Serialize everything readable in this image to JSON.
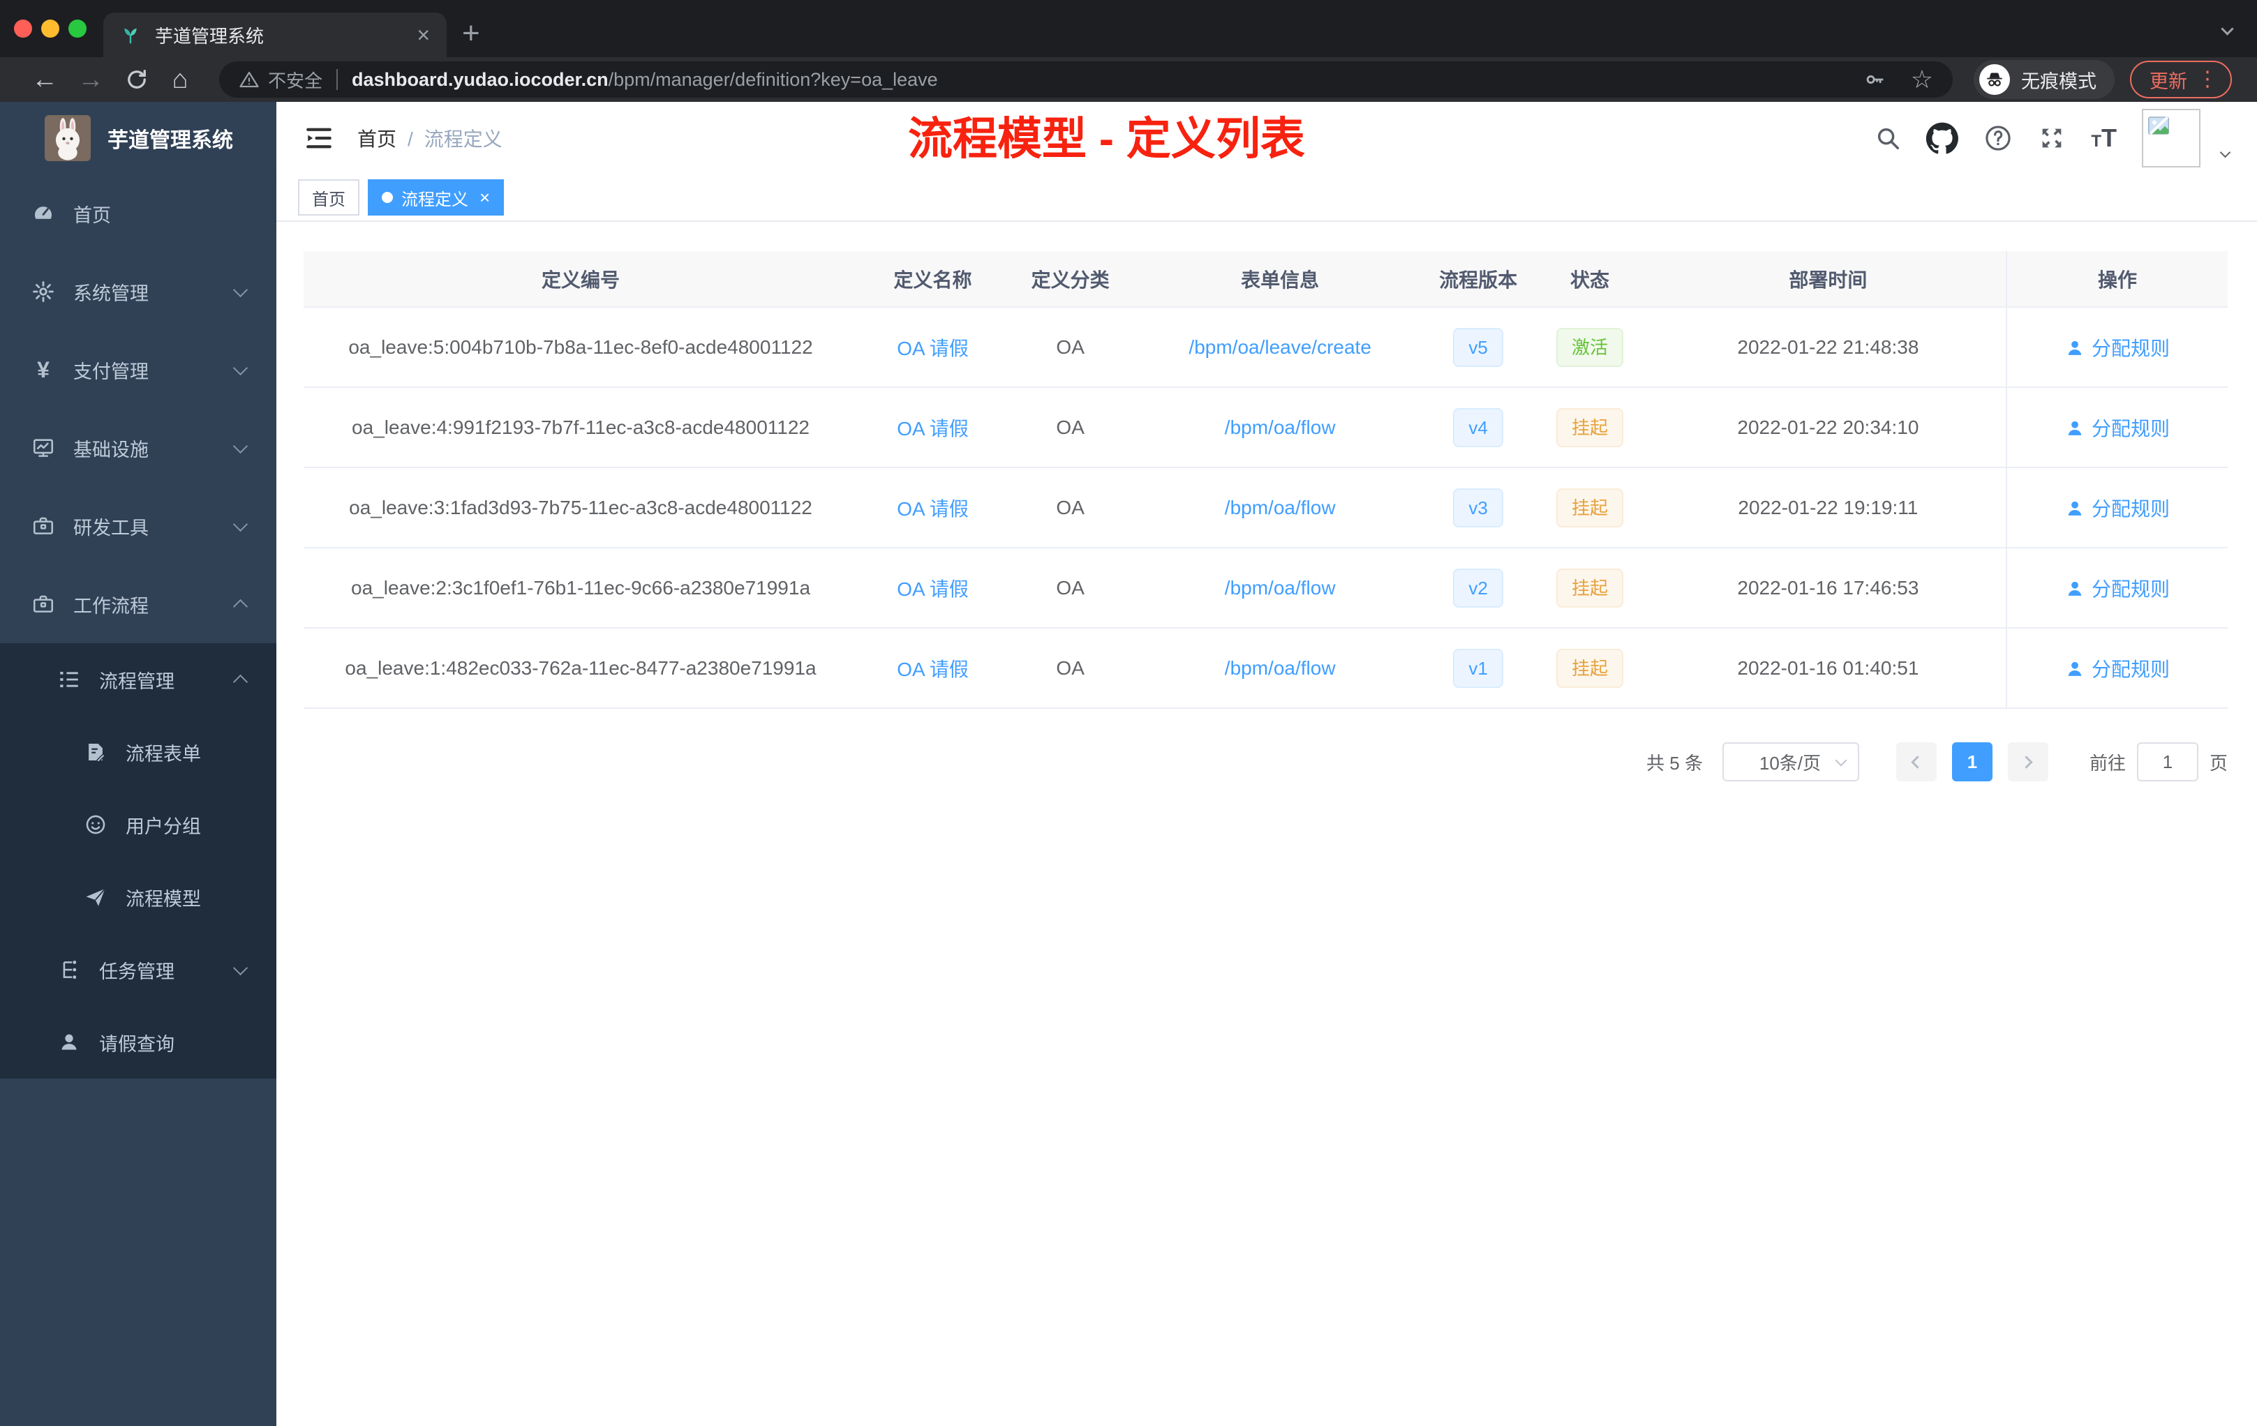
{
  "browser": {
    "tab_title": "芋道管理系统",
    "security_label": "不安全",
    "url_domain": "dashboard.yudao.iocoder.cn",
    "url_path": "/bpm/manager/definition?key=oa_leave",
    "incognito_label": "无痕模式",
    "update_label": "更新"
  },
  "sidebar": {
    "logo_title": "芋道管理系统",
    "items": [
      {
        "icon": "dashboard",
        "label": "首页",
        "level": 0
      },
      {
        "icon": "gear",
        "label": "系统管理",
        "level": 0,
        "arrow": "down"
      },
      {
        "icon": "yen",
        "label": "支付管理",
        "level": 0,
        "arrow": "down"
      },
      {
        "icon": "infra",
        "label": "基础设施",
        "level": 0,
        "arrow": "down"
      },
      {
        "icon": "toolbox",
        "label": "研发工具",
        "level": 0,
        "arrow": "down"
      },
      {
        "icon": "toolbox",
        "label": "工作流程",
        "level": 0,
        "arrow": "up"
      },
      {
        "icon": "listicon",
        "label": "流程管理",
        "level": 1,
        "arrow": "up"
      },
      {
        "icon": "form",
        "label": "流程表单",
        "level": 2
      },
      {
        "icon": "group",
        "label": "用户分组",
        "level": 2
      },
      {
        "icon": "plane",
        "label": "流程模型",
        "level": 2
      },
      {
        "icon": "task",
        "label": "任务管理",
        "level": 1,
        "arrow": "down"
      },
      {
        "icon": "person",
        "label": "请假查询",
        "level": 1
      }
    ]
  },
  "header": {
    "breadcrumb_home": "首页",
    "breadcrumb_current": "流程定义",
    "annotation": "流程模型 - 定义列表"
  },
  "tags": {
    "items": [
      {
        "label": "首页",
        "active": false
      },
      {
        "label": "流程定义",
        "active": true
      }
    ]
  },
  "table": {
    "columns": [
      "定义编号",
      "定义名称",
      "定义分类",
      "表单信息",
      "流程版本",
      "状态",
      "部署时间",
      "操作"
    ],
    "rows": [
      {
        "id": "oa_leave:5:004b710b-7b8a-11ec-8ef0-acde48001122",
        "name": "OA 请假",
        "category": "OA",
        "form": "/bpm/oa/leave/create",
        "version": "v5",
        "status": "激活",
        "status_type": "success",
        "time": "2022-01-22 21:48:38",
        "action": "分配规则"
      },
      {
        "id": "oa_leave:4:991f2193-7b7f-11ec-a3c8-acde48001122",
        "name": "OA 请假",
        "category": "OA",
        "form": "/bpm/oa/flow",
        "version": "v4",
        "status": "挂起",
        "status_type": "warning",
        "time": "2022-01-22 20:34:10",
        "action": "分配规则"
      },
      {
        "id": "oa_leave:3:1fad3d93-7b75-11ec-a3c8-acde48001122",
        "name": "OA 请假",
        "category": "OA",
        "form": "/bpm/oa/flow",
        "version": "v3",
        "status": "挂起",
        "status_type": "warning",
        "time": "2022-01-22 19:19:11",
        "action": "分配规则"
      },
      {
        "id": "oa_leave:2:3c1f0ef1-76b1-11ec-9c66-a2380e71991a",
        "name": "OA 请假",
        "category": "OA",
        "form": "/bpm/oa/flow",
        "version": "v2",
        "status": "挂起",
        "status_type": "warning",
        "time": "2022-01-16 17:46:53",
        "action": "分配规则"
      },
      {
        "id": "oa_leave:1:482ec033-762a-11ec-8477-a2380e71991a",
        "name": "OA 请假",
        "category": "OA",
        "form": "/bpm/oa/flow",
        "version": "v1",
        "status": "挂起",
        "status_type": "warning",
        "time": "2022-01-16 01:40:51",
        "action": "分配规则"
      }
    ]
  },
  "pagination": {
    "total": "共 5 条",
    "page_size": "10条/页",
    "current_page": "1",
    "goto_label": "前往",
    "goto_value": "1",
    "unit_label": "页"
  },
  "colors": {
    "primary": "#409eff",
    "success": "#67c23a",
    "warning": "#e6a23c",
    "annotation_red": "#f7220f",
    "sidebar_bg": "#304156",
    "submenu_bg": "#1f2d3d",
    "tag_active_bg": "#409eff"
  }
}
